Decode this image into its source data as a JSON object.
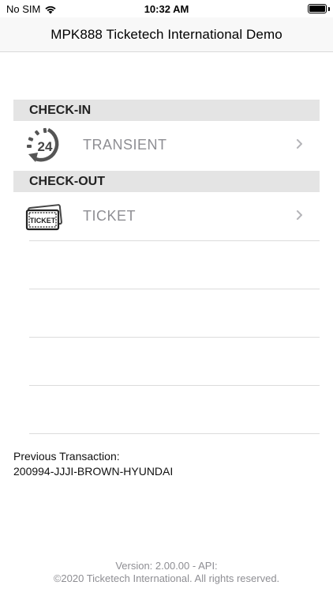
{
  "status_bar": {
    "carrier": "No SIM",
    "time": "10:32 AM",
    "wifi_icon": "wifi-icon",
    "battery_icon": "battery-icon"
  },
  "nav": {
    "title": "MPK888 Ticketech International Demo"
  },
  "check_in": {
    "header": "CHECK-IN",
    "items": [
      {
        "label": "TRANSIENT",
        "icon": "clock-24-icon"
      }
    ]
  },
  "check_out": {
    "header": "CHECK-OUT",
    "items": [
      {
        "label": "TICKET",
        "icon": "ticket-icon"
      }
    ]
  },
  "previous_transaction": {
    "label": "Previous Transaction:",
    "value": "200994-JJJI-BROWN-HYUNDAI"
  },
  "footer": {
    "version": "Version: 2.00.00 - API:",
    "copyright": "©2020 Ticketech International. All rights reserved."
  },
  "colors": {
    "section_bg": "#e4e4e4",
    "label_gray": "#8e8e93",
    "nav_bg": "#f8f8f8"
  }
}
